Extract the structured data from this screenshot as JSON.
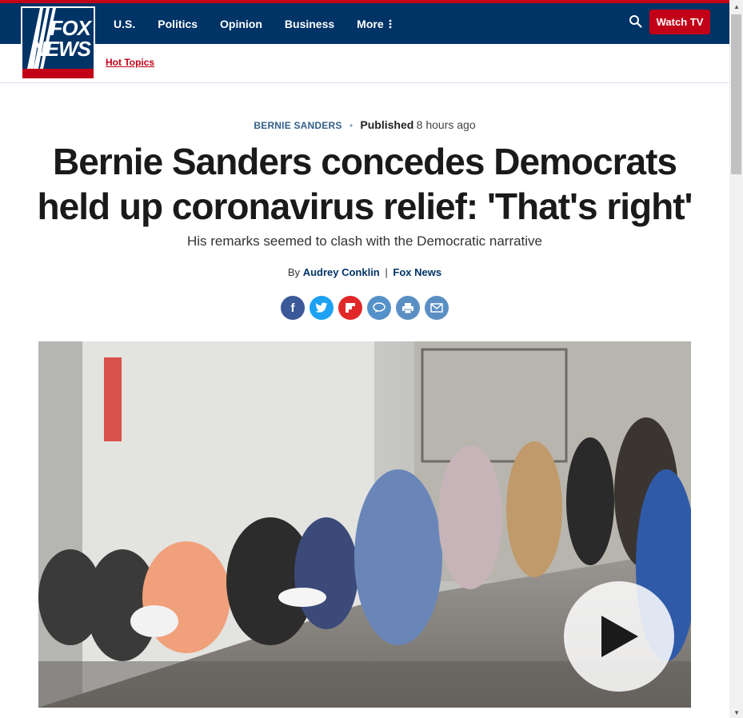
{
  "brand": {
    "logo_text_top": "FOX",
    "logo_text_bottom": "NEWS"
  },
  "nav": {
    "items": [
      {
        "label": "U.S."
      },
      {
        "label": "Politics"
      },
      {
        "label": "Opinion"
      },
      {
        "label": "Business"
      },
      {
        "label": "More"
      }
    ],
    "more_icon": "vertical-dots-icon",
    "search_icon": "search-icon",
    "watch_label": "Watch TV"
  },
  "subnav": {
    "hot_topics": "Hot Topics"
  },
  "article": {
    "category": "BERNIE SANDERS",
    "published_label": "Published",
    "published_ago": "8 hours ago",
    "headline": "Bernie Sanders concedes Democrats held up coronavirus relief: 'That's right'",
    "subhead": "His remarks seemed to clash with the Democratic narrative",
    "by_label": "By",
    "author": "Audrey Conklin",
    "separator": "|",
    "outlet": "Fox News"
  },
  "share": [
    {
      "icon": "facebook-icon",
      "glyph": "f"
    },
    {
      "icon": "twitter-icon",
      "glyph": ""
    },
    {
      "icon": "flipboard-icon",
      "glyph": ""
    },
    {
      "icon": "comment-icon",
      "glyph": ""
    },
    {
      "icon": "print-icon",
      "glyph": ""
    },
    {
      "icon": "email-icon",
      "glyph": ""
    }
  ],
  "video": {
    "play_icon": "play-icon"
  },
  "colors": {
    "brand_navy": "#003366",
    "brand_red": "#c20017"
  }
}
